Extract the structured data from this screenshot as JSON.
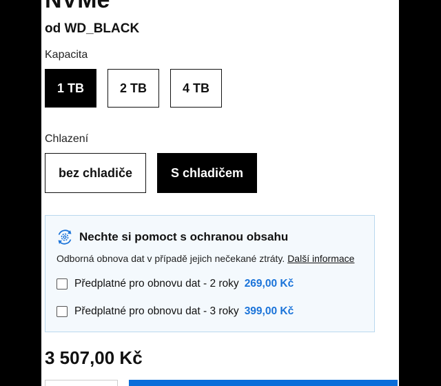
{
  "product": {
    "title_partial": "NVMe™",
    "brand": "od WD_BLACK"
  },
  "capacity": {
    "label": "Kapacita",
    "options": [
      "1 TB",
      "2 TB",
      "4 TB"
    ],
    "selected": "1 TB"
  },
  "cooling": {
    "label": "Chlazení",
    "options": [
      "bez chladiče",
      "S chladičem"
    ],
    "selected": "S chladičem"
  },
  "protection": {
    "icon": "data-recovery-gear-icon",
    "title": "Nechte si pomoct s ochranou obsahu",
    "description": "Odborná obnova dat v případě jejich nečekané ztráty.",
    "link": "Další informace",
    "plans": [
      {
        "label": "Předplatné pro obnovu dat - 2 roky",
        "price": "269,00 Kč",
        "checked": false
      },
      {
        "label": "Předplatné pro obnovu dat - 3 roky",
        "price": "399,00 Kč",
        "checked": false
      }
    ]
  },
  "price": "3 507,00 Kč",
  "colors": {
    "accent_blue": "#1a73d9",
    "selected_bg": "#000000",
    "help_bg": "#f4f9fd"
  }
}
